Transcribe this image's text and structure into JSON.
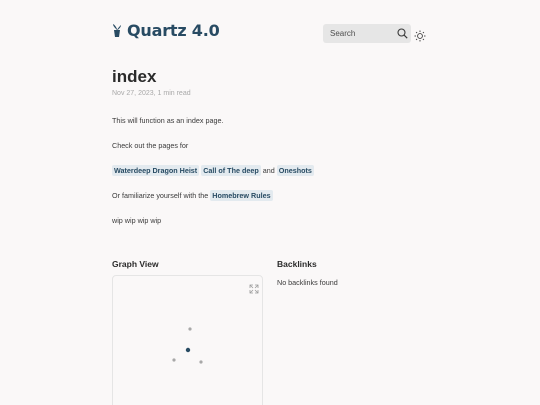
{
  "header": {
    "site_title": "Quartz 4.0",
    "search_label": "Search",
    "logo_icon": "plant-pot-icon",
    "search_icon": "search-icon",
    "theme_icon": "sun-icon"
  },
  "article": {
    "title": "index",
    "meta": "Nov 27, 2023, 1 min read",
    "p1": "This will function as an index page.",
    "p2": "Check out the pages for",
    "links": {
      "waterdeep": "Waterdeep Dragon Heist",
      "call": "Call of The deep",
      "and": "and",
      "oneshots": "Oneshots"
    },
    "p4_prefix": "Or familiarize yourself with the",
    "homebrew": "Homebrew Rules",
    "p5": "wip wip wip wip"
  },
  "graph": {
    "title": "Graph View",
    "expand_icon": "expand-icon",
    "colors": {
      "current_node": "#284b63",
      "other_node": "#a8a8a8"
    }
  },
  "backlinks": {
    "title": "Backlinks",
    "empty_text": "No backlinks found"
  },
  "colors": {
    "accent": "#284b63",
    "link_bg": "#e3eaef",
    "page_bg": "#faf8f8",
    "search_bg": "#e6e6e6"
  }
}
